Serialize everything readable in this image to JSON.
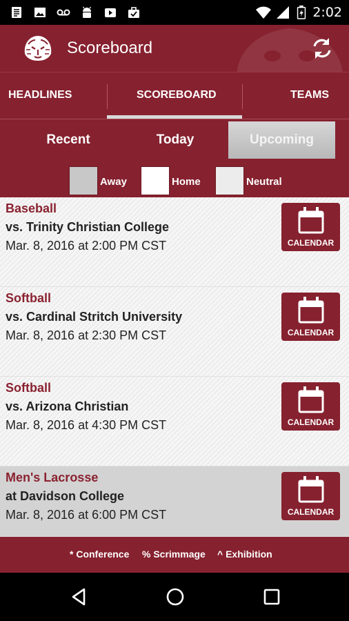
{
  "status_bar": {
    "time": "2:02",
    "icons": [
      "notes-icon",
      "image-icon",
      "voicemail-icon",
      "android-icon",
      "play-store-icon",
      "briefcase-icon",
      "wifi-icon",
      "signal-icon",
      "battery-icon"
    ]
  },
  "app_bar": {
    "title": "Scoreboard",
    "logo": "tiger-logo-icon",
    "action": "refresh-icon"
  },
  "tabs": [
    {
      "label": "HEADLINES",
      "active": false
    },
    {
      "label": "SCOREBOARD",
      "active": true
    },
    {
      "label": "TEAMS",
      "active": false
    }
  ],
  "filters": {
    "segments": [
      {
        "label": "Recent",
        "active": false
      },
      {
        "label": "Today",
        "active": false
      },
      {
        "label": "Upcoming",
        "active": true
      }
    ],
    "legend": [
      {
        "label": "Away",
        "color": "#c8c8c8"
      },
      {
        "label": "Home",
        "color": "#ffffff"
      },
      {
        "label": "Neutral",
        "color": "#ececec"
      }
    ]
  },
  "games": [
    {
      "sport": "Baseball",
      "opponent": "vs. Trinity Christian College",
      "datetime": "Mar. 8, 2016 at 2:00 PM CST",
      "button": "CALENDAR"
    },
    {
      "sport": "Softball",
      "opponent": "vs. Cardinal Stritch University",
      "datetime": "Mar. 8, 2016 at 2:30 PM CST",
      "button": "CALENDAR"
    },
    {
      "sport": "Softball",
      "opponent": "vs. Arizona Christian",
      "datetime": "Mar. 8, 2016 at 4:30 PM CST",
      "button": "CALENDAR"
    },
    {
      "sport": "Men's Lacrosse",
      "opponent": "at Davidson College",
      "datetime": "Mar. 8, 2016 at 6:00 PM CST",
      "button": "CALENDAR"
    }
  ],
  "footer": {
    "conference": "* Conference",
    "scrimmage": "% Scrimmage",
    "exhibition": "^ Exhibition"
  },
  "nav_bar": [
    "back-icon",
    "home-icon",
    "recents-icon"
  ],
  "colors": {
    "brand": "#86212f",
    "sport_text": "#8a2230",
    "highlight_row": "#d3d3d3"
  }
}
